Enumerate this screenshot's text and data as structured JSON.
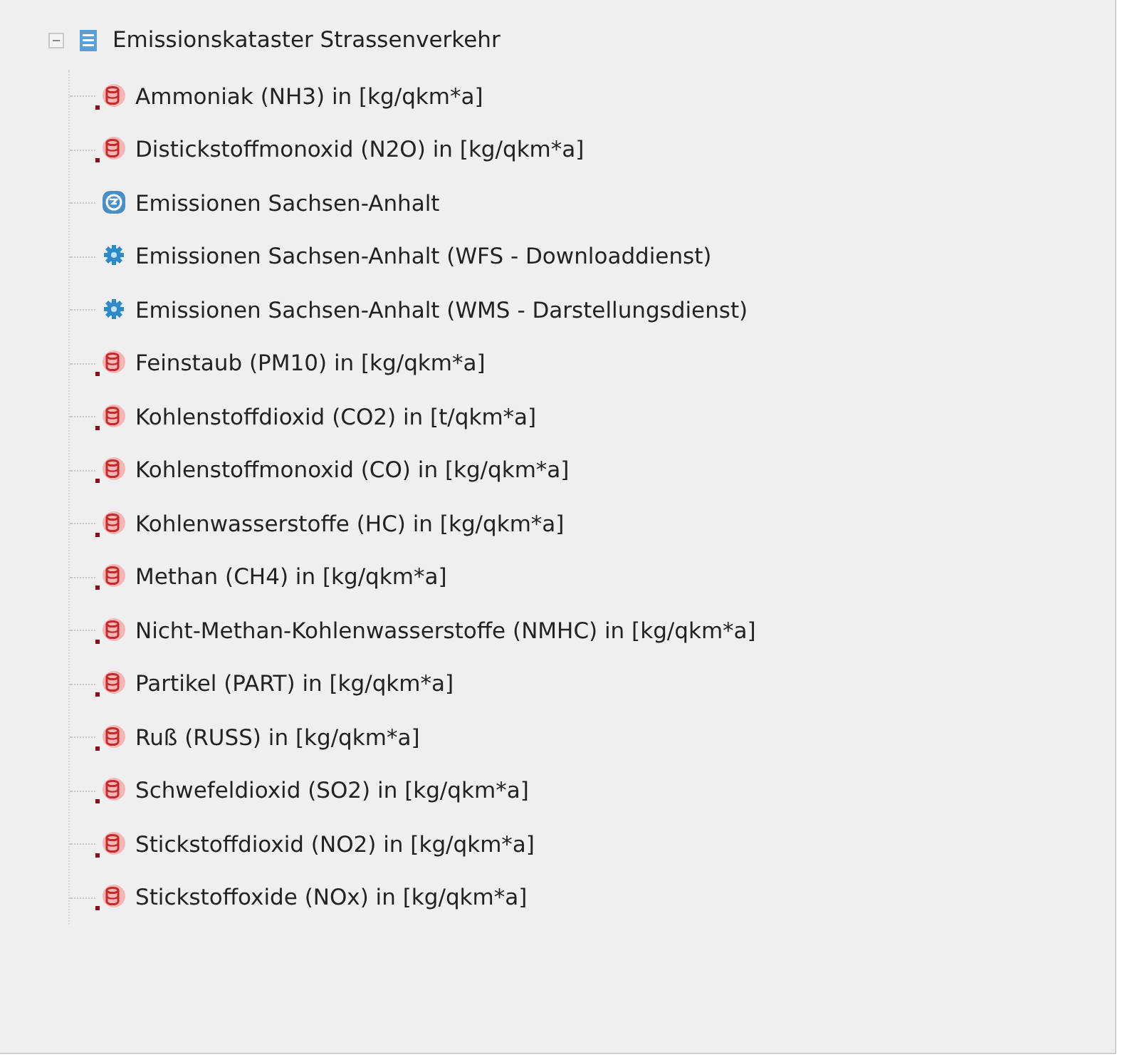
{
  "tree": {
    "label": "Emissionskataster Strassenverkehr",
    "expanded": true,
    "children": [
      {
        "label": "Ammoniak (NH3) in [kg/qkm*a]",
        "kind": "dataset"
      },
      {
        "label": "Distickstoffmonoxid (N2O) in [kg/qkm*a]",
        "kind": "dataset"
      },
      {
        "label": "Emissionen Sachsen-Anhalt",
        "kind": "application"
      },
      {
        "label": "Emissionen Sachsen-Anhalt (WFS - Downloaddienst)",
        "kind": "service"
      },
      {
        "label": "Emissionen Sachsen-Anhalt (WMS - Darstellungsdienst)",
        "kind": "service"
      },
      {
        "label": "Feinstaub (PM10) in [kg/qkm*a]",
        "kind": "dataset"
      },
      {
        "label": "Kohlenstoffdioxid (CO2) in [t/qkm*a]",
        "kind": "dataset"
      },
      {
        "label": "Kohlenstoffmonoxid (CO) in [kg/qkm*a]",
        "kind": "dataset"
      },
      {
        "label": "Kohlenwasserstoffe (HC) in [kg/qkm*a]",
        "kind": "dataset"
      },
      {
        "label": "Methan (CH4) in [kg/qkm*a]",
        "kind": "dataset"
      },
      {
        "label": "Nicht-Methan-Kohlenwasserstoffe (NMHC) in [kg/qkm*a]",
        "kind": "dataset"
      },
      {
        "label": "Partikel (PART) in [kg/qkm*a]",
        "kind": "dataset"
      },
      {
        "label": "Ruß (RUSS) in [kg/qkm*a]",
        "kind": "dataset"
      },
      {
        "label": "Schwefeldioxid (SO2) in [kg/qkm*a]",
        "kind": "dataset"
      },
      {
        "label": "Stickstoffdioxid (NO2) in [kg/qkm*a]",
        "kind": "dataset"
      },
      {
        "label": "Stickstoffoxide (NOx) in [kg/qkm*a]",
        "kind": "dataset"
      }
    ]
  }
}
